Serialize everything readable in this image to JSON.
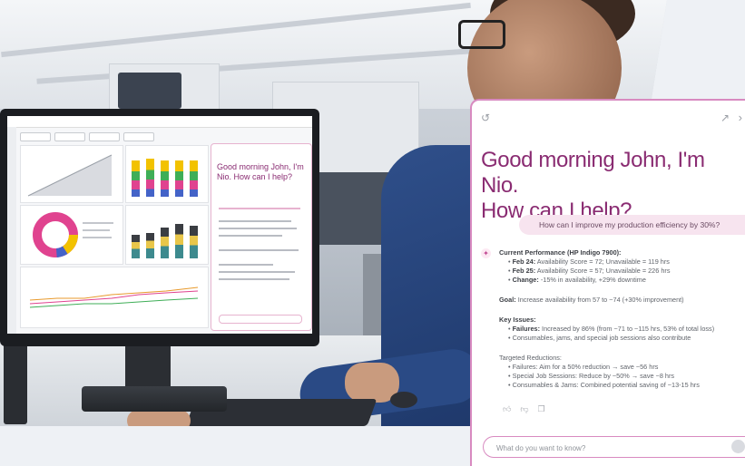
{
  "chat": {
    "greeting_line1": "Good morning John, I'm Nio.",
    "greeting_line2": "How can I help?",
    "user_message": "How can I improve my production efficiency by 30%?",
    "response": {
      "section1_title": "Current Performance (HP Indigo 7900):",
      "section1_items": [
        {
          "label": "Feb 24:",
          "text": "Availability Score = 72; Unavailable = 119 hrs"
        },
        {
          "label": "Feb 25:",
          "text": "Availability Score = 57; Unavailable = 226 hrs"
        },
        {
          "label": "Change:",
          "text": "-15% in availability, +29% downtime"
        }
      ],
      "goal_label": "Goal:",
      "goal_text": "Increase availability from 57 to ~74 (+30% improvement)",
      "issues_title": "Key Issues:",
      "issues_items": [
        {
          "label": "Failures:",
          "text": "Increased by 86% (from ~71 to ~115 hrs, 53% of total loss)"
        },
        {
          "label": "",
          "text": "Consumables, jams, and special job sessions also contribute"
        }
      ],
      "reductions_title": "Targeted Reductions:",
      "reductions_items": [
        "Failures: Aim for a 50% reduction → save ~56 hrs",
        "Special Job Sessions: Reduce by ~50% → save ~8 hrs",
        "Consumables & Jams: Combined potential saving of ~13-15 hrs"
      ]
    },
    "input_placeholder": "What do you want to know?"
  },
  "mini_screen": {
    "greeting": "Good morning John, I'm Nio. How can I help?"
  },
  "colors": {
    "brand": "#8a2c72",
    "border_accent": "#d88ac0",
    "bubble": "#f7e4ef"
  },
  "icons": [
    "history-icon",
    "expand-icon",
    "close-icon",
    "thumbs-up-icon",
    "thumbs-down-icon",
    "copy-icon",
    "send-icon"
  ]
}
